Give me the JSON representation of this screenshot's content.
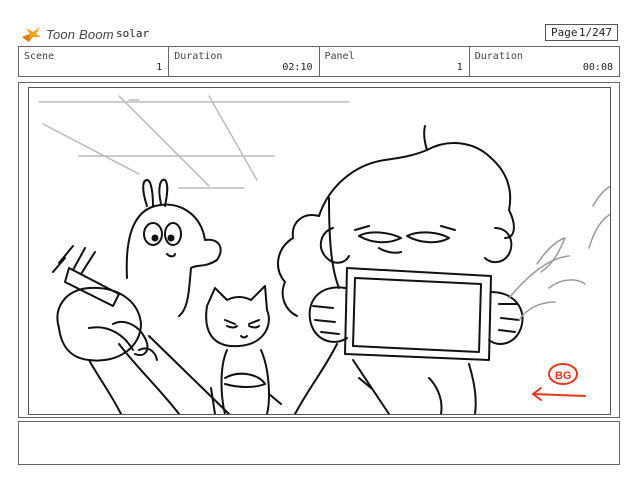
{
  "header": {
    "brand": "Toon Boom",
    "project": "solar",
    "page_label": "Page",
    "page_value": "1/247"
  },
  "info": {
    "scene_label": "Scene",
    "scene_value": "1",
    "duration_label": "Duration",
    "scene_duration": "02:10",
    "panel_label": "Panel",
    "panel_value": "1",
    "panel_duration_label": "Duration",
    "panel_duration": "00:08"
  },
  "panel": {
    "annotation": "BG",
    "annotation_color": "#e03a1e"
  },
  "notes": {}
}
